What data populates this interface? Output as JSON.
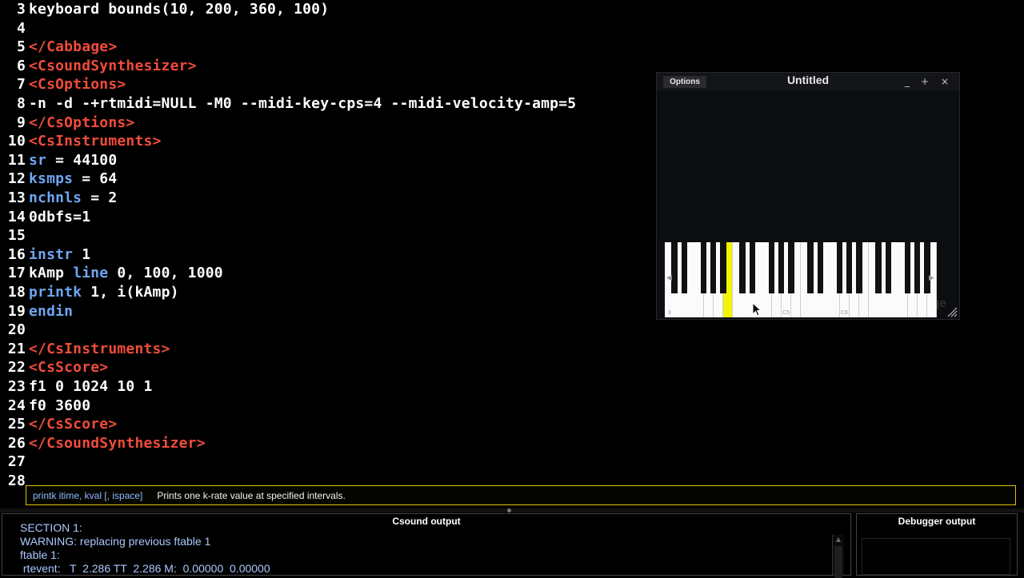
{
  "editor": {
    "lines": [
      {
        "n": "3",
        "segments": [
          {
            "text": "keyboard bounds(10, 200, 360, 100)",
            "color": "white"
          }
        ]
      },
      {
        "n": "4",
        "segments": []
      },
      {
        "n": "5",
        "segments": [
          {
            "text": "</Cabbage>",
            "color": "red"
          }
        ]
      },
      {
        "n": "6",
        "segments": [
          {
            "text": "<CsoundSynthesizer>",
            "color": "red"
          }
        ]
      },
      {
        "n": "7",
        "segments": [
          {
            "text": "<CsOptions>",
            "color": "red"
          }
        ]
      },
      {
        "n": "8",
        "segments": [
          {
            "text": "-n -d -+rtmidi=NULL -M0 --midi-key-cps=4 --midi-velocity-amp=5",
            "color": "white"
          }
        ]
      },
      {
        "n": "9",
        "segments": [
          {
            "text": "</CsOptions>",
            "color": "red"
          }
        ]
      },
      {
        "n": "10",
        "segments": [
          {
            "text": "<CsInstruments>",
            "color": "red"
          }
        ]
      },
      {
        "n": "11",
        "segments": [
          {
            "text": "sr",
            "color": "blue"
          },
          {
            "text": " = 44100",
            "color": "white"
          }
        ]
      },
      {
        "n": "12",
        "segments": [
          {
            "text": "ksmps",
            "color": "blue"
          },
          {
            "text": " = 64",
            "color": "white"
          }
        ]
      },
      {
        "n": "13",
        "segments": [
          {
            "text": "nchnls",
            "color": "blue"
          },
          {
            "text": " = 2",
            "color": "white"
          }
        ]
      },
      {
        "n": "14",
        "segments": [
          {
            "text": "0dbfs=1",
            "color": "white"
          }
        ]
      },
      {
        "n": "15",
        "segments": []
      },
      {
        "n": "16",
        "segments": [
          {
            "text": "instr",
            "color": "blue"
          },
          {
            "text": " 1",
            "color": "white"
          }
        ]
      },
      {
        "n": "17",
        "segments": [
          {
            "text": "kAmp ",
            "color": "white"
          },
          {
            "text": "line",
            "color": "blue"
          },
          {
            "text": " 0, 100, 1000",
            "color": "white"
          }
        ]
      },
      {
        "n": "18",
        "segments": [
          {
            "text": "printk",
            "color": "blue"
          },
          {
            "text": " 1, i(kAmp)",
            "color": "white"
          }
        ]
      },
      {
        "n": "19",
        "segments": [
          {
            "text": "endin",
            "color": "blue"
          }
        ]
      },
      {
        "n": "20",
        "segments": []
      },
      {
        "n": "21",
        "segments": [
          {
            "text": "</CsInstruments>",
            "color": "red"
          }
        ]
      },
      {
        "n": "22",
        "segments": [
          {
            "text": "<CsScore>",
            "color": "red"
          }
        ]
      },
      {
        "n": "23",
        "segments": [
          {
            "text": "f1 0 1024 10 1",
            "color": "white"
          }
        ]
      },
      {
        "n": "24",
        "segments": [
          {
            "text": "f0 3600",
            "color": "white"
          }
        ]
      },
      {
        "n": "25",
        "segments": [
          {
            "text": "</CsScore>",
            "color": "red"
          }
        ]
      },
      {
        "n": "26",
        "segments": [
          {
            "text": "</CsoundSynthesizer>",
            "color": "red"
          }
        ]
      },
      {
        "n": "27",
        "segments": []
      },
      {
        "n": "28",
        "segments": []
      }
    ]
  },
  "tooltip": {
    "signature": "printk itime, kval [, ispace]",
    "description": "Prints one k-rate value at specified intervals."
  },
  "csound_output": {
    "title": "Csound output",
    "lines": [
      "SECTION 1:",
      "WARNING: replacing previous ftable 1",
      "ftable 1:",
      " rtevent:   T  2.286 TT  2.286 M:  0.00000  0.00000"
    ]
  },
  "debugger_output": {
    "title": "Debugger output"
  },
  "plugin_window": {
    "options_label": "Options",
    "title": "Untitled",
    "minimize_glyph": "_",
    "maximize_glyph": "+",
    "close_glyph": "×",
    "watermark": "ge",
    "keyboard": {
      "white_key_count": 28,
      "active_white_key": 6,
      "octave_labels": [
        {
          "key": 0,
          "text": "3"
        },
        {
          "key": 12,
          "text": "C5"
        },
        {
          "key": 18,
          "text": "C6"
        }
      ],
      "highlight_color": "#f2f500"
    }
  },
  "colors": {
    "red": "#f04c3c",
    "blue": "#6fa6f2",
    "white": "#ffffff"
  },
  "icons": [
    "mouse-pointer-icon",
    "resize-grip-icon",
    "scroll-left-arrow-icon",
    "scroll-right-arrow-icon"
  ]
}
